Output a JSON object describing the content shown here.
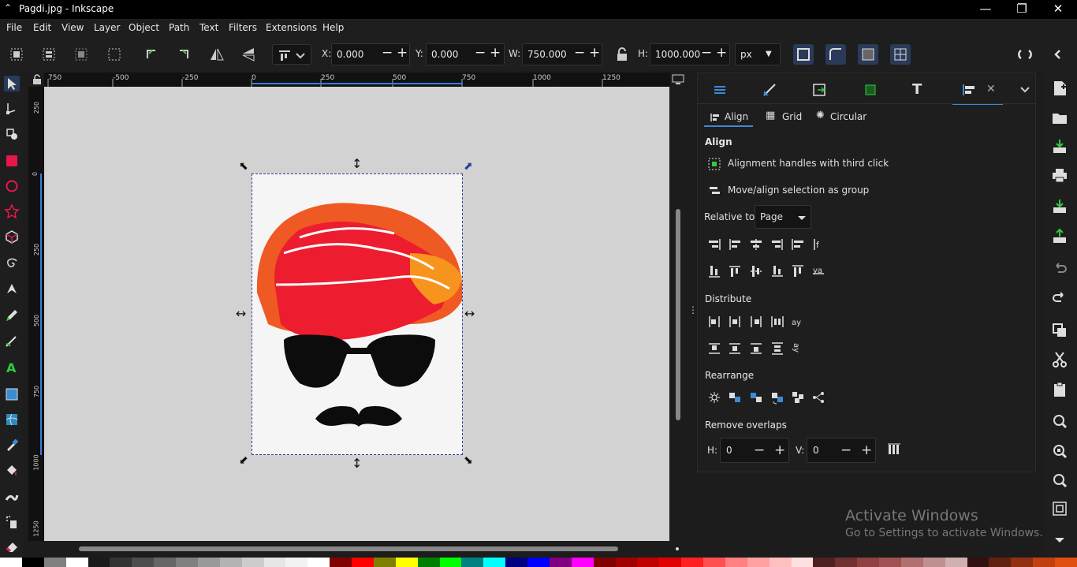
{
  "window": {
    "title": "Pagdi.jpg - Inkscape",
    "controls": [
      "—",
      "❐",
      "✕"
    ]
  },
  "menu": [
    "File",
    "Edit",
    "View",
    "Layer",
    "Object",
    "Path",
    "Text",
    "Filters",
    "Extensions",
    "Help"
  ],
  "toolbar": {
    "x_label": "X:",
    "x_value": "0.000",
    "y_label": "Y:",
    "y_value": "0.000",
    "w_label": "W:",
    "w_value": "750.000",
    "h_label": "H:",
    "h_value": "1000.000",
    "unit": "px"
  },
  "ruler": {
    "h_ticks": [
      "750",
      "-500",
      "-250",
      "0",
      "250",
      "500",
      "750",
      "1000",
      "1250"
    ],
    "v_ticks": [
      "250",
      "0",
      "250",
      "500",
      "750",
      "1000",
      "1250"
    ]
  },
  "dock": {
    "tabs": [
      "Align",
      "Grid",
      "Circular"
    ],
    "align_title": "Align",
    "handles_label": "Alignment handles with third click",
    "group_label": "Move/align selection as group",
    "relative_label": "Relative to:",
    "relative_value": "Page",
    "distribute_title": "Distribute",
    "rearrange_title": "Rearrange",
    "overlaps_title": "Remove overlaps",
    "h_label": "H:",
    "h_value": "0",
    "v_label": "V:",
    "v_value": "0"
  },
  "watermark": {
    "line1": "Activate Windows",
    "line2": "Go to Settings to activate Windows."
  },
  "palette": [
    "#ffffff",
    "#000000",
    "#808080",
    "#ffffff",
    "#1a1a1a",
    "#333333",
    "#4d4d4d",
    "#666666",
    "#808080",
    "#999999",
    "#b3b3b3",
    "#cccccc",
    "#e6e6e6",
    "#f2f2f2",
    "#ffffff",
    "#800000",
    "#ff0000",
    "#808000",
    "#ffff00",
    "#008000",
    "#00ff00",
    "#008080",
    "#00ffff",
    "#000080",
    "#0000ff",
    "#800080",
    "#ff00ff",
    "#800000",
    "#a00000",
    "#c00000",
    "#e00000",
    "#ff2020",
    "#ff5050",
    "#ff8080",
    "#ffa0a0",
    "#ffc0c0",
    "#ffe0e0",
    "#502020",
    "#703030",
    "#904040",
    "#a05050",
    "#b07070",
    "#c09090",
    "#d0b0b0",
    "#301010",
    "#602010",
    "#903010",
    "#c04010",
    "#e05010"
  ]
}
